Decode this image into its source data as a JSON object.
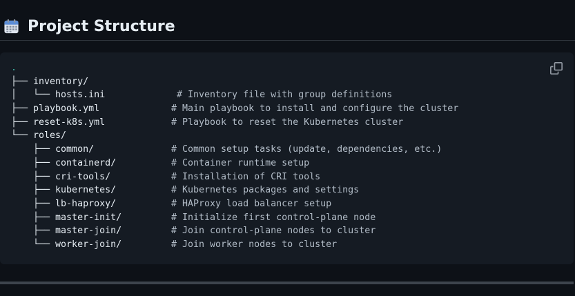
{
  "heading": {
    "icon": "calendar-icon",
    "title": "Project Structure"
  },
  "code_block": {
    "copy_icon": "copy-icon",
    "root": ".",
    "lines": [
      {
        "tree": "├── inventory/",
        "comment": ""
      },
      {
        "tree": "│   └── hosts.ini",
        "comment": "# Inventory file with group definitions"
      },
      {
        "tree": "├── playbook.yml",
        "comment": "# Main playbook to install and configure the cluster"
      },
      {
        "tree": "├── reset-k8s.yml",
        "comment": "# Playbook to reset the Kubernetes cluster"
      },
      {
        "tree": "└── roles/",
        "comment": ""
      },
      {
        "tree": "    ├── common/",
        "comment": "# Common setup tasks (update, dependencies, etc.)"
      },
      {
        "tree": "    ├── containerd/",
        "comment": "# Container runtime setup"
      },
      {
        "tree": "    ├── cri-tools/",
        "comment": "# Installation of CRI tools"
      },
      {
        "tree": "    ├── kubernetes/",
        "comment": "# Kubernetes packages and settings"
      },
      {
        "tree": "    ├── lb-haproxy/",
        "comment": "# HAProxy load balancer setup"
      },
      {
        "tree": "    ├── master-init/",
        "comment": "# Initialize first control-plane node"
      },
      {
        "tree": "    ├── master-join/",
        "comment": "# Join control-plane nodes to cluster"
      },
      {
        "tree": "    └── worker-join/",
        "comment": "# Join worker nodes to cluster"
      }
    ]
  }
}
